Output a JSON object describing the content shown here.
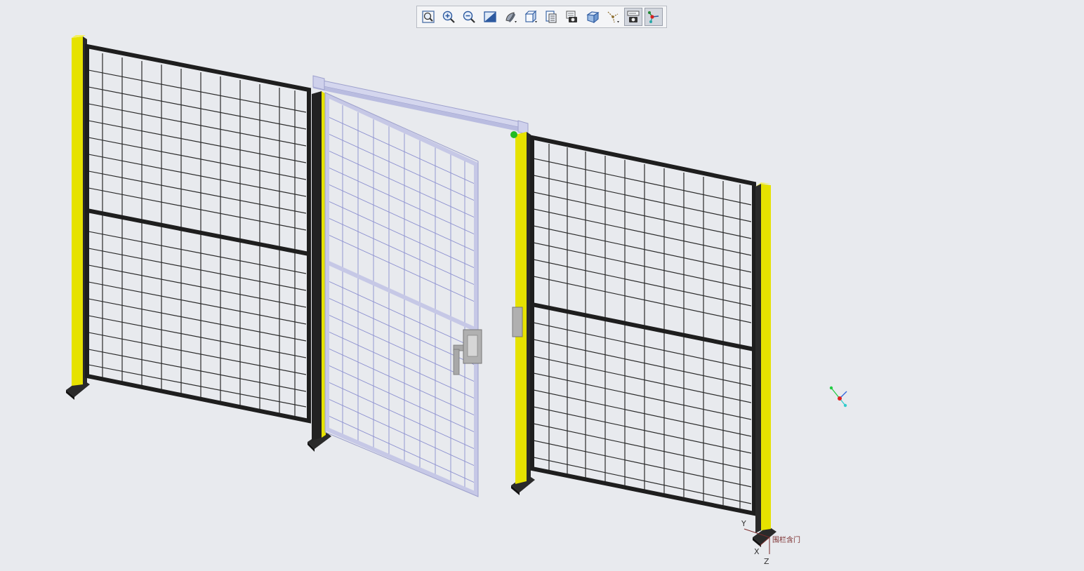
{
  "toolbar": {
    "buttons": [
      {
        "icon": "zoom-fit-icon",
        "active": false
      },
      {
        "icon": "zoom-in-icon",
        "active": false
      },
      {
        "icon": "zoom-out-icon",
        "active": false
      },
      {
        "icon": "zoom-window-icon",
        "active": false
      },
      {
        "icon": "shading-icon",
        "active": false
      },
      {
        "icon": "saved-views-icon",
        "active": false
      },
      {
        "icon": "view-manager-icon",
        "active": false
      },
      {
        "icon": "snapshot-icon",
        "active": false
      },
      {
        "icon": "perspective-icon",
        "active": false
      },
      {
        "icon": "datum-display-icon",
        "active": false
      },
      {
        "icon": "annotation-display-icon",
        "active": true
      },
      {
        "icon": "spin-center-icon",
        "active": true
      }
    ]
  },
  "model": {
    "name": "围栏含门",
    "coordinate_system": {
      "x_label": "X",
      "y_label": "Y",
      "z_label": "Z"
    }
  },
  "colors": {
    "background": "#e8eaee",
    "post_yellow": "#e8e400",
    "frame_dark": "#1e1e1e",
    "door_frame": "#c9cbe6",
    "door_mesh": "#8c90d0",
    "green_marker": "#22bb22"
  }
}
